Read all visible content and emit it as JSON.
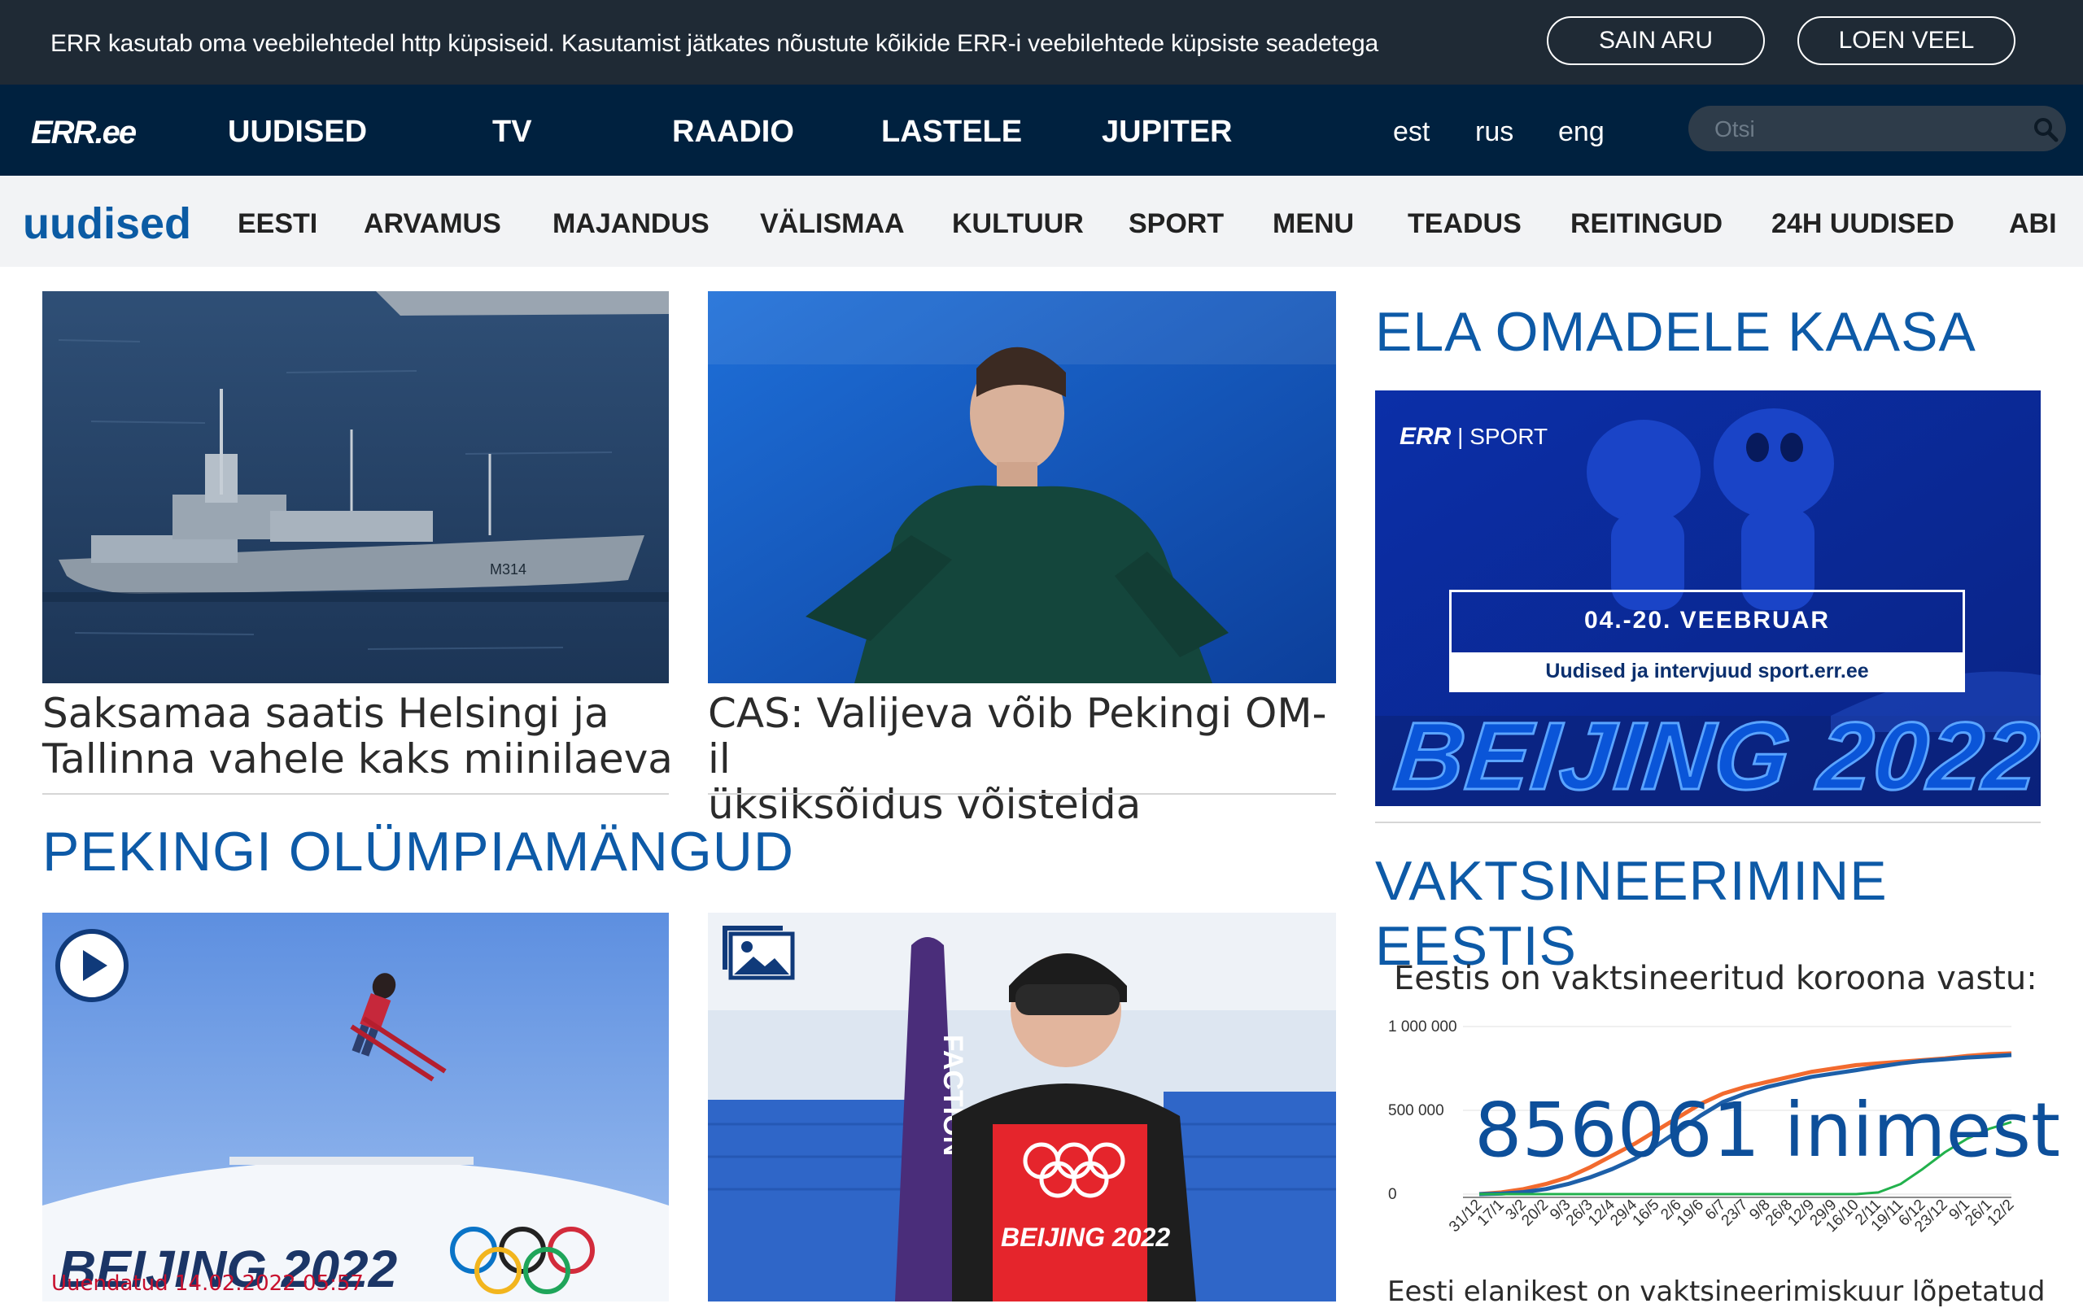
{
  "cookie_bar": {
    "text": "ERR kasutab oma veebilehtedel http küpsiseid. Kasutamist jätkates nõustute kõikide ERR-i veebilehtede küpsiste seadetega",
    "agree_label": "SAIN ARU",
    "more_label": "LOEN VEEL"
  },
  "header": {
    "logo_text": "ERR.ee",
    "nav": [
      "UUDISED",
      "TV",
      "RAADIO",
      "LASTELE",
      "JUPITER"
    ],
    "languages": [
      "est",
      "rus",
      "eng"
    ],
    "search_placeholder": "Otsi"
  },
  "section_nav": {
    "brand": "uudised",
    "items": [
      "EESTI",
      "ARVAMUS",
      "MAJANDUS",
      "VÄLISMAA",
      "KULTUUR",
      "SPORT",
      "MENU",
      "TEADUS",
      "REITINGUD",
      "24H UUDISED",
      "ABI"
    ]
  },
  "articles": [
    {
      "headline_1": "Saksamaa saatis Helsingi ja",
      "headline_2": "Tallinna vahele kaks miinilaeva",
      "ship_mark": "M314"
    },
    {
      "headline_1": "CAS: Valijeva võib Pekingi OM-il",
      "headline_2": "üksiksõidus võistelda"
    }
  ],
  "olympics_section": {
    "title": "PEKINGI OLÜMPIAMÄNGUD",
    "updated": "Uuendatud 14.02.2022 05:57",
    "photo_text_left": "BEIJING 2022",
    "ski_brand": "FACTION",
    "bib_text": "BEIJING 2022"
  },
  "sidebar": {
    "promo_title": "ELA OMADELE KAASA",
    "promo": {
      "channel": "SPORT",
      "dates": "04.-20. VEEBRUAR",
      "tagline": "Uudised ja intervjuud sport.err.ee",
      "event": "BEIJING 2022"
    },
    "vaccine_title": "VAKTSINEERIMINE EESTIS",
    "vaccine_heading": "Eestis on vaktsineeritud koroona vastu:",
    "vaccine_count": "856061 inimest",
    "vaccine_foot": "Eesti elanikest on vaktsineerimiskuur lõpetatud"
  },
  "chart_data": {
    "type": "line",
    "x": [
      "31/12",
      "17/1",
      "3/2",
      "20/2",
      "9/3",
      "26/3",
      "12/4",
      "29/4",
      "16/5",
      "2/6",
      "19/6",
      "6/7",
      "23/7",
      "9/8",
      "26/8",
      "12/9",
      "29/9",
      "16/10",
      "2/11",
      "19/11",
      "6/12",
      "23/12",
      "9/1",
      "26/1",
      "12/2"
    ],
    "yticks": [
      "0",
      "500 000",
      "1 000 000"
    ],
    "ylim": [
      0,
      1000000
    ],
    "series": [
      {
        "color": "#f26a2e",
        "values": [
          0,
          10000,
          30000,
          60000,
          100000,
          160000,
          230000,
          300000,
          380000,
          460000,
          540000,
          600000,
          640000,
          670000,
          700000,
          730000,
          750000,
          770000,
          780000,
          790000,
          800000,
          810000,
          825000,
          835000,
          840000
        ]
      },
      {
        "color": "#1d5fa8",
        "values": [
          0,
          3000,
          12000,
          30000,
          60000,
          100000,
          150000,
          210000,
          290000,
          380000,
          470000,
          550000,
          600000,
          640000,
          670000,
          700000,
          720000,
          740000,
          760000,
          780000,
          795000,
          805000,
          815000,
          822000,
          830000
        ]
      },
      {
        "color": "#22b14c",
        "values": [
          0,
          0,
          0,
          0,
          0,
          0,
          0,
          0,
          0,
          0,
          0,
          0,
          0,
          0,
          0,
          0,
          0,
          0,
          10000,
          60000,
          150000,
          250000,
          330000,
          390000,
          430000
        ]
      }
    ]
  },
  "colors": {
    "cookie_bg": "#1f2a35",
    "nav_bg": "#00213f",
    "accent_blue": "#0d5aa7",
    "updated_red": "#c8102e"
  }
}
